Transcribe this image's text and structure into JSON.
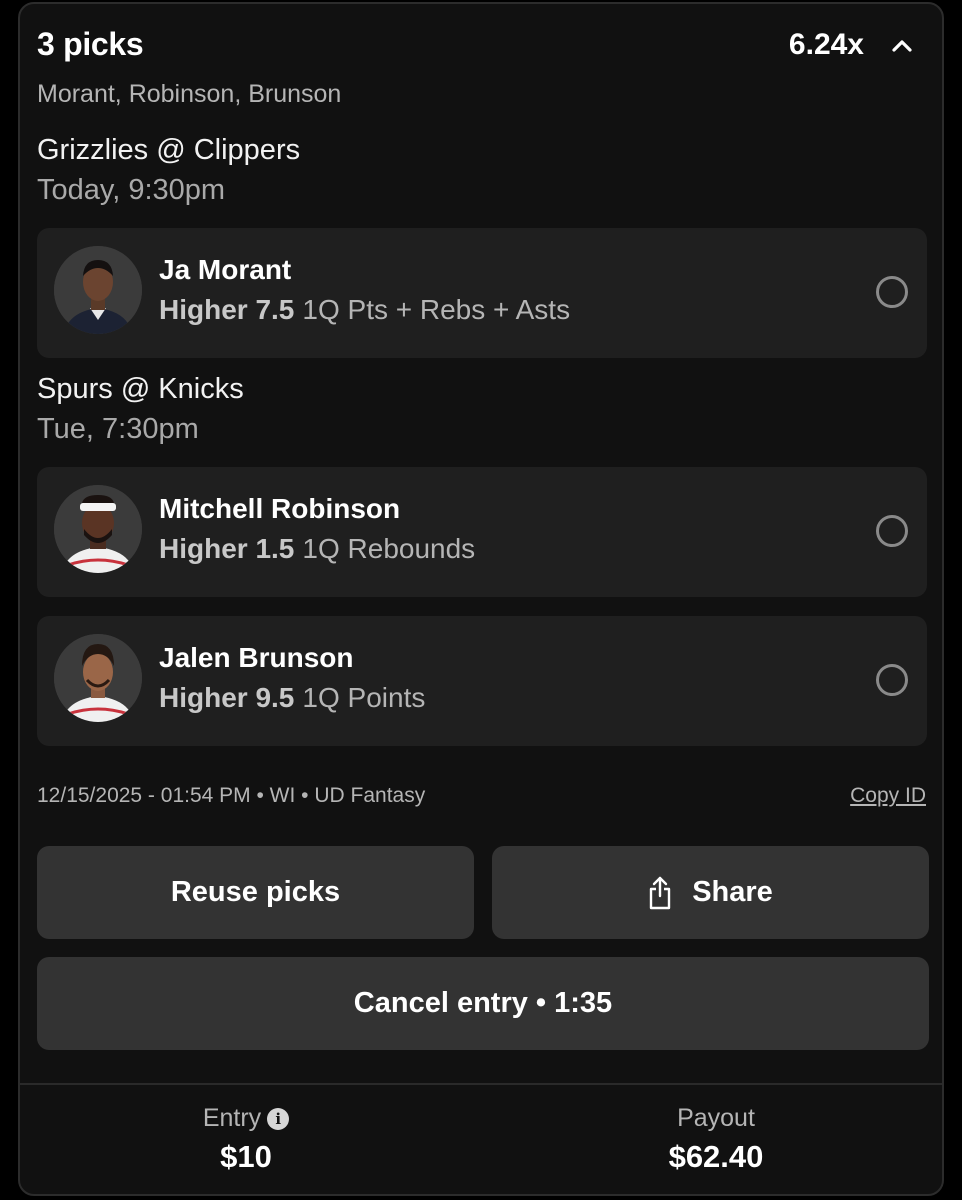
{
  "header": {
    "title": "3 picks",
    "multiplier": "6.24x",
    "players_summary": "Morant, Robinson, Brunson"
  },
  "games": [
    {
      "title": "Grizzlies @ Clippers",
      "time": "Today, 9:30pm",
      "picks": [
        {
          "player": "Ja Morant",
          "direction": "Higher 7.5",
          "stat": "1Q Pts + Rebs + Asts"
        }
      ]
    },
    {
      "title": "Spurs @ Knicks",
      "time": "Tue, 7:30pm",
      "picks": [
        {
          "player": "Mitchell Robinson",
          "direction": "Higher 1.5",
          "stat": "1Q Rebounds"
        },
        {
          "player": "Jalen Brunson",
          "direction": "Higher 9.5",
          "stat": "1Q Points"
        }
      ]
    }
  ],
  "meta": {
    "info": "12/15/2025 - 01:54 PM • WI • UD Fantasy",
    "copy_id": "Copy ID"
  },
  "actions": {
    "reuse": "Reuse picks",
    "share": "Share",
    "cancel": "Cancel entry • 1:35"
  },
  "footer": {
    "entry_label": "Entry",
    "entry_value": "$10",
    "payout_label": "Payout",
    "payout_value": "$62.40"
  },
  "icons": {
    "collapse": "chevron-up-icon",
    "share": "share-icon",
    "info": "info-icon"
  },
  "colors": {
    "background": "#000000",
    "card": "#111111",
    "pick_card": "#1f1f1f",
    "button": "#333333"
  }
}
